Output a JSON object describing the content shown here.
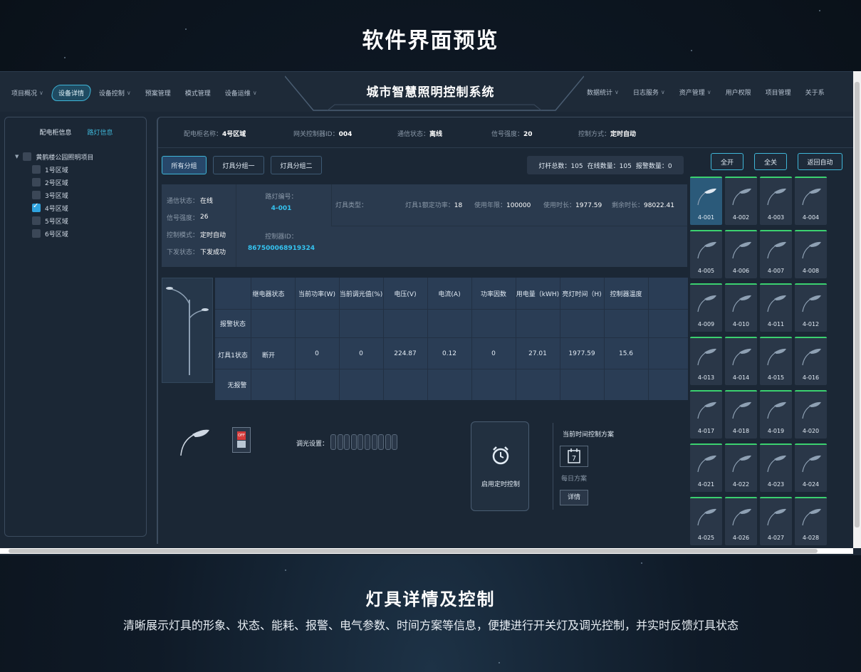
{
  "banner": {
    "title": "软件界面预览"
  },
  "app": {
    "title": "城市智慧照明控制系统",
    "nav_left": [
      {
        "label": "项目概况",
        "dropdown": true
      },
      {
        "label": "设备详情",
        "dropdown": false,
        "active": true
      },
      {
        "label": "设备控制",
        "dropdown": true
      },
      {
        "label": "预案管理",
        "dropdown": false
      },
      {
        "label": "模式管理",
        "dropdown": false
      },
      {
        "label": "设备运维",
        "dropdown": true
      }
    ],
    "nav_right": [
      {
        "label": "数据统计",
        "dropdown": true
      },
      {
        "label": "日志服务",
        "dropdown": true
      },
      {
        "label": "资产管理",
        "dropdown": true
      },
      {
        "label": "用户权限",
        "dropdown": false
      },
      {
        "label": "项目管理",
        "dropdown": false
      },
      {
        "label": "关于系",
        "dropdown": false
      }
    ]
  },
  "left_panel": {
    "tabs": [
      "配电柜信息",
      "路灯信息"
    ],
    "tree_root": "黄鹤楼公园照明项目",
    "areas": [
      {
        "label": "1号区域",
        "checked": false
      },
      {
        "label": "2号区域",
        "checked": false
      },
      {
        "label": "3号区域",
        "checked": false
      },
      {
        "label": "4号区域",
        "checked": true
      },
      {
        "label": "5号区域",
        "checked": false
      },
      {
        "label": "6号区域",
        "checked": false
      }
    ]
  },
  "info_bar": {
    "cabinet_name_label": "配电柜名称：",
    "cabinet_name": "4号区域",
    "gateway_label": "网关控制器ID：",
    "gateway": "004",
    "comm_label": "通信状态：",
    "comm": "离线",
    "signal_label": "信号强度：",
    "signal": "20",
    "mode_label": "控制方式：",
    "mode": "定时自动"
  },
  "groups": [
    "所有分组",
    "灯具分组一",
    "灯具分组二"
  ],
  "stats": {
    "total_label": "灯杆总数：",
    "total": "105",
    "online_label": "在线数量：",
    "online": "105",
    "alarm_label": "报警数量：",
    "alarm": "0"
  },
  "controls": [
    "全开",
    "全关",
    "返回自动"
  ],
  "detail": {
    "comm_label": "通信状态：",
    "comm": "在线",
    "signal_label": "信号强度：",
    "signal": "26",
    "mode_label": "控制模式：",
    "mode": "定时自动",
    "send_label": "下发状态：",
    "send": "下发成功",
    "lamp_no_label": "路灯编号：",
    "lamp_no": "4-001",
    "controller_label": "控制器ID：",
    "controller": "867500068919324",
    "type_label": "灯具类型：",
    "power_label": "灯具1额定功率：",
    "power": "18",
    "life_label": "使用年限：",
    "life": "100000",
    "used_label": "使用时长：",
    "used": "1977.59",
    "remain_label": "剩余时长：",
    "remain": "98022.41"
  },
  "table": {
    "headers": [
      "继电器状态",
      "当前功率(W)",
      "当前调光值(%)",
      "电压(V)",
      "电流(A)",
      "功率因数",
      "用电量（kWH)",
      "亮灯时间（H)",
      "控制器温度"
    ],
    "alarm_row_label": "报警状态",
    "lamp_row_label": "灯具1状态",
    "lamp_row": [
      "断开",
      "0",
      "0",
      "224.87",
      "0.12",
      "0",
      "27.01",
      "1977.59",
      "15.6"
    ],
    "no_alarm_label": "无报警"
  },
  "bottom": {
    "switch_off_text": "OFF",
    "dim_label": "调光设置：",
    "timer_label": "启用定时控制",
    "plan_title": "当前时间控制方案",
    "calendar_day": "7",
    "plan_name": "每日方案",
    "detail_btn": "详情"
  },
  "lamps": [
    "4-001",
    "4-002",
    "4-003",
    "4-004",
    "4-005",
    "4-006",
    "4-007",
    "4-008",
    "4-009",
    "4-010",
    "4-011",
    "4-012",
    "4-013",
    "4-014",
    "4-015",
    "4-016",
    "4-017",
    "4-018",
    "4-019",
    "4-020",
    "4-021",
    "4-022",
    "4-023",
    "4-024",
    "4-025",
    "4-026",
    "4-027",
    "4-028"
  ],
  "footer": {
    "title": "灯具详情及控制",
    "desc": "清晰展示灯具的形象、状态、能耗、报警、电气参数、时间方案等信息，便捷进行开关灯及调光控制，并实时反馈灯具状态"
  },
  "colors": {
    "accent": "#3fb6d8",
    "online_tile_border": "#3bd16f",
    "lamp_id": "#35c3f0",
    "off_red": "#d63b3b"
  }
}
